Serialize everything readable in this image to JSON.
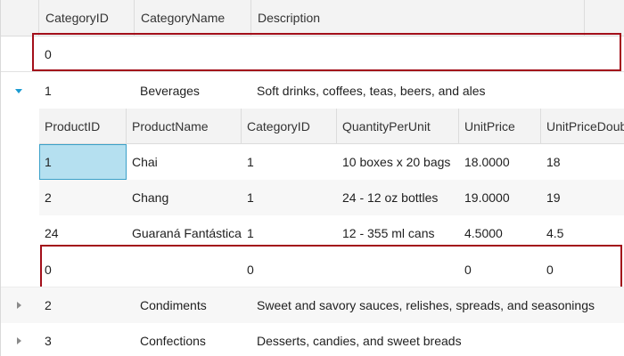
{
  "grid": {
    "columns": [
      "CategoryID",
      "CategoryName",
      "Description"
    ],
    "add_row": {
      "category_id": "0"
    },
    "rows": [
      {
        "id": "1",
        "name": "Beverages",
        "description": "Soft drinks, coffees, teas, beers, and ales",
        "expanded": true
      },
      {
        "id": "2",
        "name": "Condiments",
        "description": "Sweet and savory sauces, relishes, spreads, and seasonings",
        "expanded": false
      },
      {
        "id": "3",
        "name": "Confections",
        "description": "Desserts, candies, and sweet breads",
        "expanded": false
      }
    ]
  },
  "nested": {
    "columns": [
      "ProductID",
      "ProductName",
      "CategoryID",
      "QuantityPerUnit",
      "UnitPrice",
      "UnitPriceDouble"
    ],
    "rows": [
      {
        "product_id": "1",
        "product_name": "Chai",
        "category_id": "1",
        "qty": "10 boxes x 20 bags",
        "price": "18.0000",
        "price_double": "18"
      },
      {
        "product_id": "2",
        "product_name": "Chang",
        "category_id": "1",
        "qty": "24 - 12 oz bottles",
        "price": "19.0000",
        "price_double": "19"
      },
      {
        "product_id": "24",
        "product_name": "Guaraná Fantástica",
        "category_id": "1",
        "qty": "12 - 355 ml cans",
        "price": "4.5000",
        "price_double": "4.5"
      }
    ],
    "add_row": {
      "product_id": "0",
      "category_id": "0",
      "price": "0",
      "price_double": "0"
    }
  },
  "colors": {
    "accent_border": "#a30f1a",
    "selection": "#b5e0f0",
    "expander_expanded": "#1b9bd1",
    "expander_collapsed": "#8a8a8a"
  },
  "icons": {
    "expanded": "triangle-down-icon",
    "collapsed": "triangle-right-icon"
  }
}
